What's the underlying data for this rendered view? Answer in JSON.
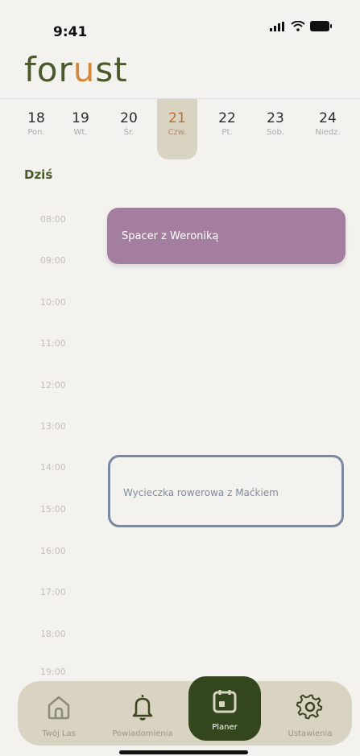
{
  "status": {
    "time": "9:41"
  },
  "logo": {
    "part1": "for",
    "part2": "u",
    "part3": "st"
  },
  "week": {
    "days": [
      {
        "num": "18",
        "label": "Pon."
      },
      {
        "num": "19",
        "label": "Wt."
      },
      {
        "num": "20",
        "label": "Śr."
      },
      {
        "num": "21",
        "label": "Czw."
      },
      {
        "num": "22",
        "label": "Pt."
      },
      {
        "num": "23",
        "label": "Sob."
      },
      {
        "num": "24",
        "label": "Niedz."
      }
    ],
    "active_index": 3
  },
  "today_label": "Dziś",
  "hours": [
    "08:00",
    "09:00",
    "10:00",
    "11:00",
    "12:00",
    "13:00",
    "14:00",
    "15:00",
    "16:00",
    "17:00",
    "18:00",
    "19:00"
  ],
  "events": [
    {
      "title": "Spacer z Weroniką",
      "color": "#a37e9e"
    },
    {
      "title": "Wycieczka rowerowa z Maćkiem",
      "color": "#7889a0"
    }
  ],
  "nav": {
    "items": [
      {
        "label": "Twój Las",
        "icon": "home-icon"
      },
      {
        "label": "Powiadomienia",
        "icon": "bell-icon"
      },
      {
        "label": "Planer",
        "icon": "calendar-icon"
      },
      {
        "label": "Ustawienia",
        "icon": "gear-icon"
      }
    ],
    "active_index": 2
  },
  "colors": {
    "accent": "#c36b34",
    "brand_green": "#4a5a2a",
    "nav_active": "#33461d",
    "background": "#f4f2ef"
  }
}
